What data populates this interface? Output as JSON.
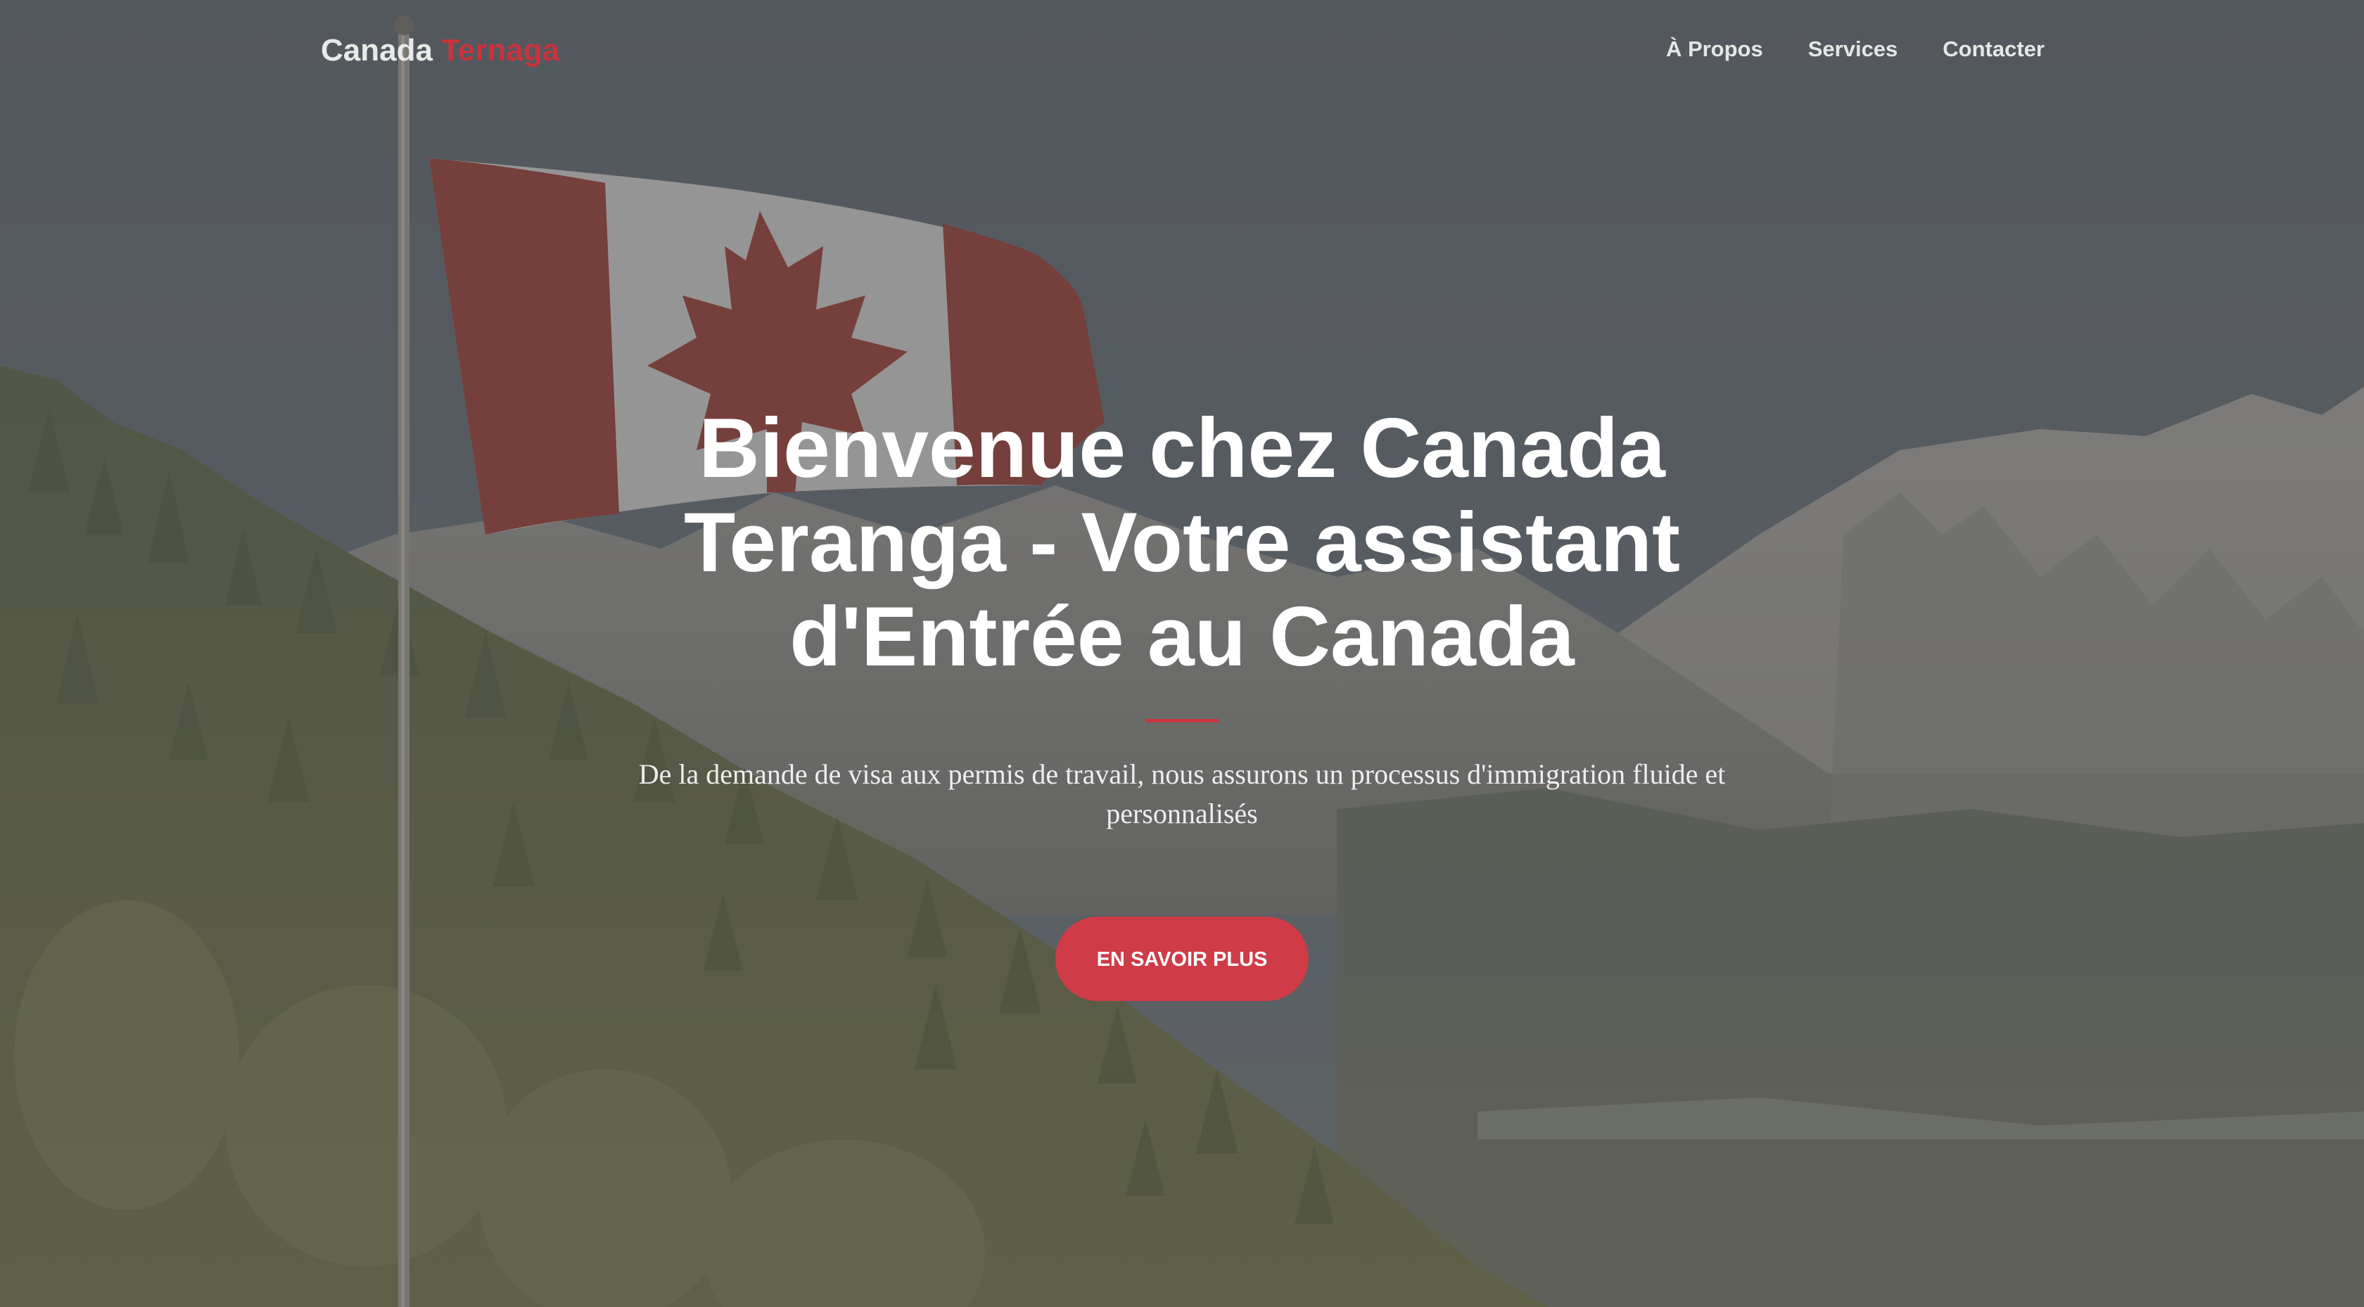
{
  "brand": {
    "name_part1": "Canada",
    "name_part2": "Ternaga"
  },
  "nav": {
    "items": [
      {
        "label": "À Propos"
      },
      {
        "label": "Services"
      },
      {
        "label": "Contacter"
      }
    ]
  },
  "hero": {
    "title": "Bienvenue chez Canada Teranga - Votre assistant d'Entrée au Canada",
    "subtitle": "De la demande de visa aux permis de travail, nous assurons un processus d'immigration fluide et personnalisés",
    "cta_label": "EN SAVOIR PLUS"
  },
  "background": {
    "icon": "canadian-flag-mountain-landscape",
    "colors": {
      "sky": "#5b6166",
      "mountain": "#7b7b76",
      "forest": "#5f6440",
      "flag_red": "#8a3c33",
      "accent": "#c6343e",
      "button": "#cf3b47"
    }
  }
}
